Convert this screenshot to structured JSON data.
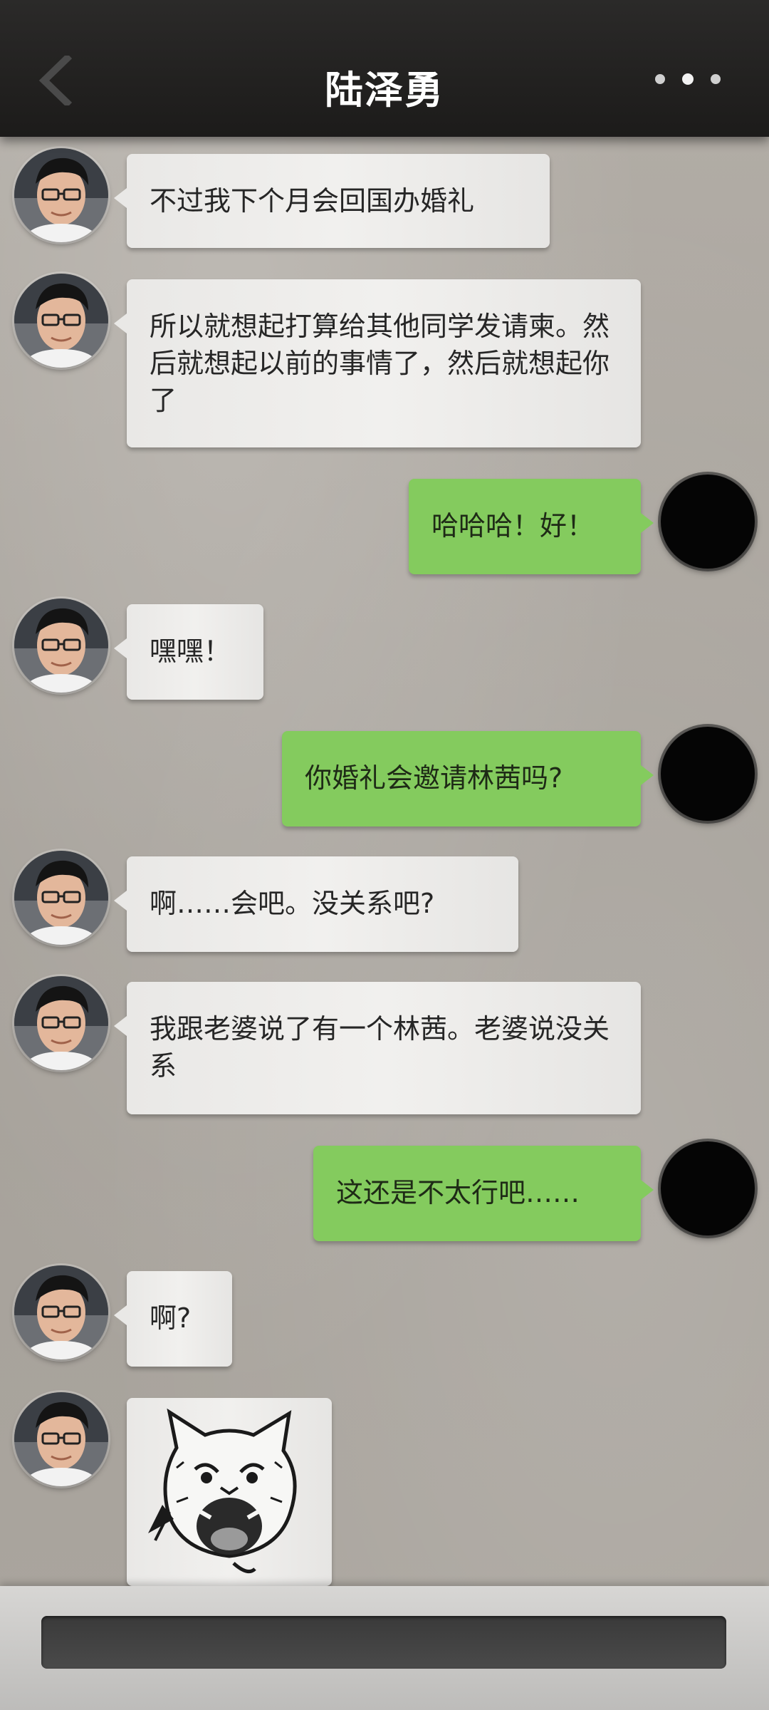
{
  "header": {
    "title": "陆泽勇",
    "back_icon": "chevron-left-icon",
    "more_icon": "more-dots-icon"
  },
  "messages": [
    {
      "side": "left",
      "text": "不过我下个月会回国办婚礼"
    },
    {
      "side": "left",
      "text": "所以就想起打算给其他同学发请柬。然后就想起以前的事情了，然后就想起你了"
    },
    {
      "side": "right",
      "text": "哈哈哈！好！"
    },
    {
      "side": "left",
      "text": "嘿嘿！"
    },
    {
      "side": "right",
      "text": "你婚礼会邀请林茜吗?"
    },
    {
      "side": "left",
      "text": "啊……会吧。没关系吧?"
    },
    {
      "side": "left",
      "text": "我跟老婆说了有一个林茜。老婆说没关系"
    },
    {
      "side": "right",
      "text": "这还是不太行吧……"
    },
    {
      "side": "left",
      "text": "啊?"
    },
    {
      "side": "left",
      "type": "sticker",
      "sticker": "screaming-cat-sticker"
    }
  ],
  "input": {
    "value": ""
  }
}
